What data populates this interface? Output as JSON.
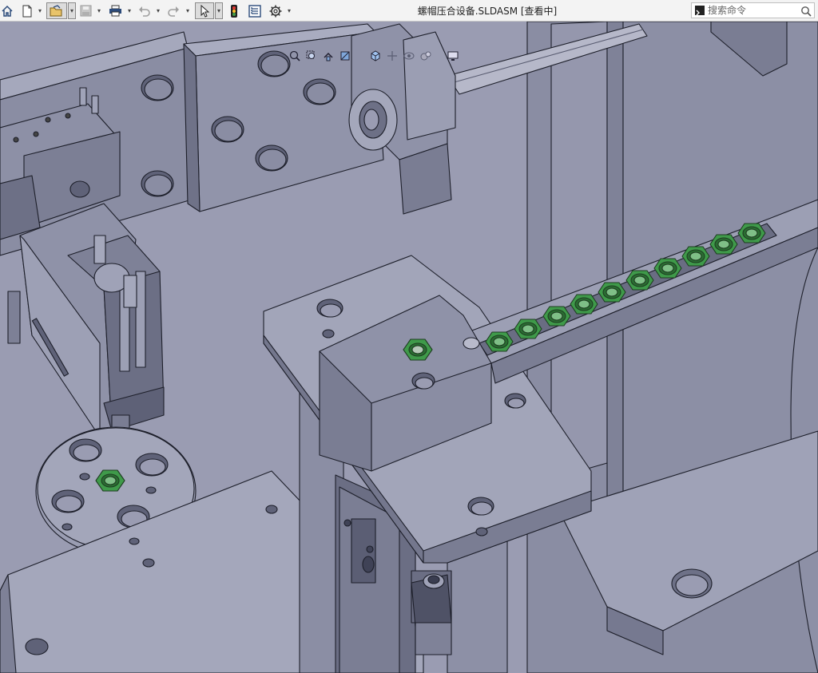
{
  "window": {
    "title": "螺帽压合设备.SLDASM [查看中]"
  },
  "toolbar": {
    "icons": [
      "home-icon",
      "new-document-icon",
      "open-folder-icon",
      "save-icon",
      "print-icon",
      "undo-icon",
      "redo-icon",
      "select-pointer-icon",
      "rebuild-traffic-light-icon",
      "file-properties-icon",
      "options-gear-icon"
    ]
  },
  "search": {
    "placeholder": "搜索命令",
    "icons": [
      "command-prompt-icon",
      "search-icon"
    ]
  },
  "heads_up_toolbar": {
    "icons": [
      "zoom-to-fit-icon",
      "zoom-to-area-icon",
      "previous-view-icon",
      "section-view-icon",
      "view-orientation-icon",
      "display-style-icon",
      "hide-show-items-icon",
      "edit-appearance-icon",
      "apply-scene-icon",
      "view-settings-icon"
    ]
  },
  "colors": {
    "background": "#9a9cb2",
    "part_face": "#8a8da3",
    "part_face_light": "#a3a6ba",
    "part_face_dark": "#6e7187",
    "edge": "#1d1f2a",
    "nut_green": "#3f9a4a",
    "nut_green_dark": "#2a6d32"
  }
}
